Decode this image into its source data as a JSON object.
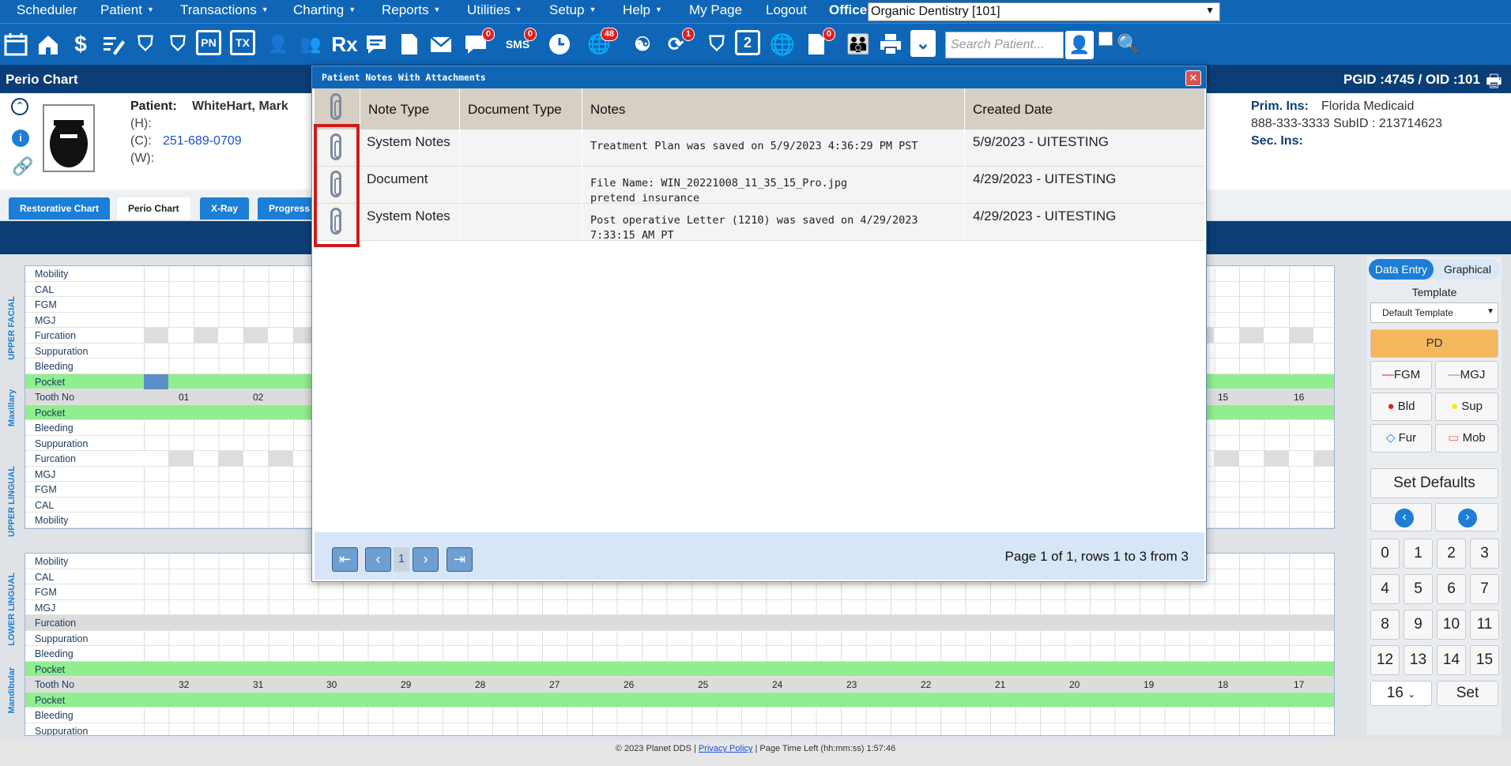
{
  "menu": {
    "items": [
      "Scheduler",
      "Patient",
      "Transactions",
      "Charting",
      "Reports",
      "Utilities",
      "Setup",
      "Help",
      "My Page",
      "Logout"
    ],
    "office_label": "Office",
    "office_value": "Organic Dentistry [101]"
  },
  "toolbar": {
    "search_placeholder": "Search Patient...",
    "badges": {
      "messages": "0",
      "sms": "0",
      "globe": "48",
      "alerts": "0",
      "recall": "1",
      "attachments": "0"
    },
    "labels": {
      "pn": "PN",
      "tx": "TX",
      "rx": "Rx",
      "sms": "SMS",
      "two": "2"
    }
  },
  "titlebar": {
    "title": "Perio Chart",
    "ids": "PGID :4745  /  OID :101"
  },
  "patient": {
    "name_label": "Patient:",
    "name": "WhiteHart, Mark",
    "home_label": "(H):",
    "cell_label": "(C):",
    "cell": "251-689-0709",
    "work_label": "(W):",
    "prim_ins_label": "Prim. Ins:",
    "prim_ins": "Florida Medicaid",
    "ins_phone": "888-333-3333 SubID : 213714623",
    "sec_ins_label": "Sec. Ins:"
  },
  "tabs": [
    "Restorative Chart",
    "Perio Chart",
    "X-Ray",
    "Progress"
  ],
  "chart": {
    "upper_rows": [
      "Mobility",
      "CAL",
      "FGM",
      "MGJ",
      "Furcation",
      "Suppuration",
      "Bleeding",
      "Pocket",
      "Tooth No",
      "Pocket",
      "Bleeding",
      "Suppuration",
      "Furcation",
      "MGJ",
      "FGM",
      "CAL",
      "Mobility"
    ],
    "lower_rows": [
      "Mobility",
      "CAL",
      "FGM",
      "MGJ",
      "Furcation",
      "Suppuration",
      "Bleeding",
      "Pocket",
      "Tooth No",
      "Pocket",
      "Bleeding",
      "Suppuration"
    ],
    "side_labels": {
      "upper_facial": "UPPER FACIAL",
      "maxillary": "Maxillary",
      "upper_lingual": "UPPER LINGUAL",
      "lower_lingual": "LOWER LINGUAL",
      "mandibular": "Mandibular"
    },
    "upper_teeth_visible": [
      "01",
      "02",
      "15",
      "16"
    ],
    "lower_teeth": [
      "32",
      "31",
      "30",
      "29",
      "28",
      "27",
      "26",
      "25",
      "24",
      "23",
      "22",
      "21",
      "20",
      "19",
      "18",
      "17"
    ]
  },
  "right_panel": {
    "mode_tabs": [
      "Data Entry",
      "Graphical"
    ],
    "template_label": "Template",
    "template_value": "Default Template",
    "pd": "PD",
    "buttons": [
      "FGM",
      "MGJ",
      "Bld",
      "Sup",
      "Fur",
      "Mob"
    ],
    "set_defaults": "Set Defaults",
    "keypad": [
      "0",
      "1",
      "2",
      "3",
      "4",
      "5",
      "6",
      "7",
      "8",
      "9",
      "10",
      "11",
      "12",
      "13",
      "14",
      "15"
    ],
    "tooth_select": "16",
    "set": "Set"
  },
  "modal": {
    "title": "Patient Notes With Attachments",
    "columns": [
      "Note Type",
      "Document Type",
      "Notes",
      "Created Date"
    ],
    "rows": [
      {
        "note_type": "System Notes",
        "doc_type": "",
        "notes_1": "Treatment Plan was saved on 5/9/2023 4:36:29 PM PST",
        "notes_2": "",
        "created": "5/9/2023 - UITESTING"
      },
      {
        "note_type": "Document",
        "doc_type": "",
        "notes_1": "File Name: WIN_20221008_11_35_15_Pro.jpg",
        "notes_2": "pretend insurance",
        "created": "4/29/2023 - UITESTING"
      },
      {
        "note_type": "System Notes",
        "doc_type": "",
        "notes_1": "Post operative Letter (1210) was saved on 4/29/2023",
        "notes_2": "7:33:15 AM PT",
        "created": "4/29/2023 - UITESTING"
      }
    ],
    "pager": {
      "current": "1",
      "status": "Page 1 of 1, rows 1 to 3 from 3"
    }
  },
  "footer": {
    "copyright": "© 2023 Planet DDS |",
    "policy": "Privacy Policy",
    "time": "|  Page Time Left (hh:mm:ss) 1:57:46"
  }
}
